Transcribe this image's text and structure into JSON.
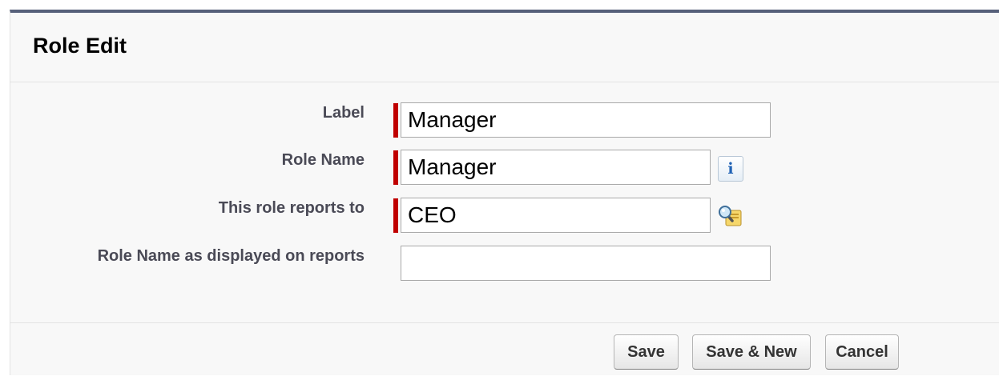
{
  "header": {
    "title": "Role Edit"
  },
  "form": {
    "fields": [
      {
        "label": "Label",
        "value": "Manager",
        "required": true
      },
      {
        "label": "Role Name",
        "value": "Manager",
        "required": true,
        "trailing_icon": "info-icon"
      },
      {
        "label": "This role reports to",
        "value": "CEO",
        "required": true,
        "trailing_icon": "lookup-icon"
      },
      {
        "label": "Role Name as displayed on reports",
        "value": "",
        "required": false
      }
    ]
  },
  "buttons": {
    "save": "Save",
    "save_new": "Save & New",
    "cancel": "Cancel"
  },
  "colors": {
    "header_border": "#56607a",
    "required_marker": "#c00000",
    "panel_background": "#f8f8f8",
    "label_text": "#4a4a56"
  }
}
